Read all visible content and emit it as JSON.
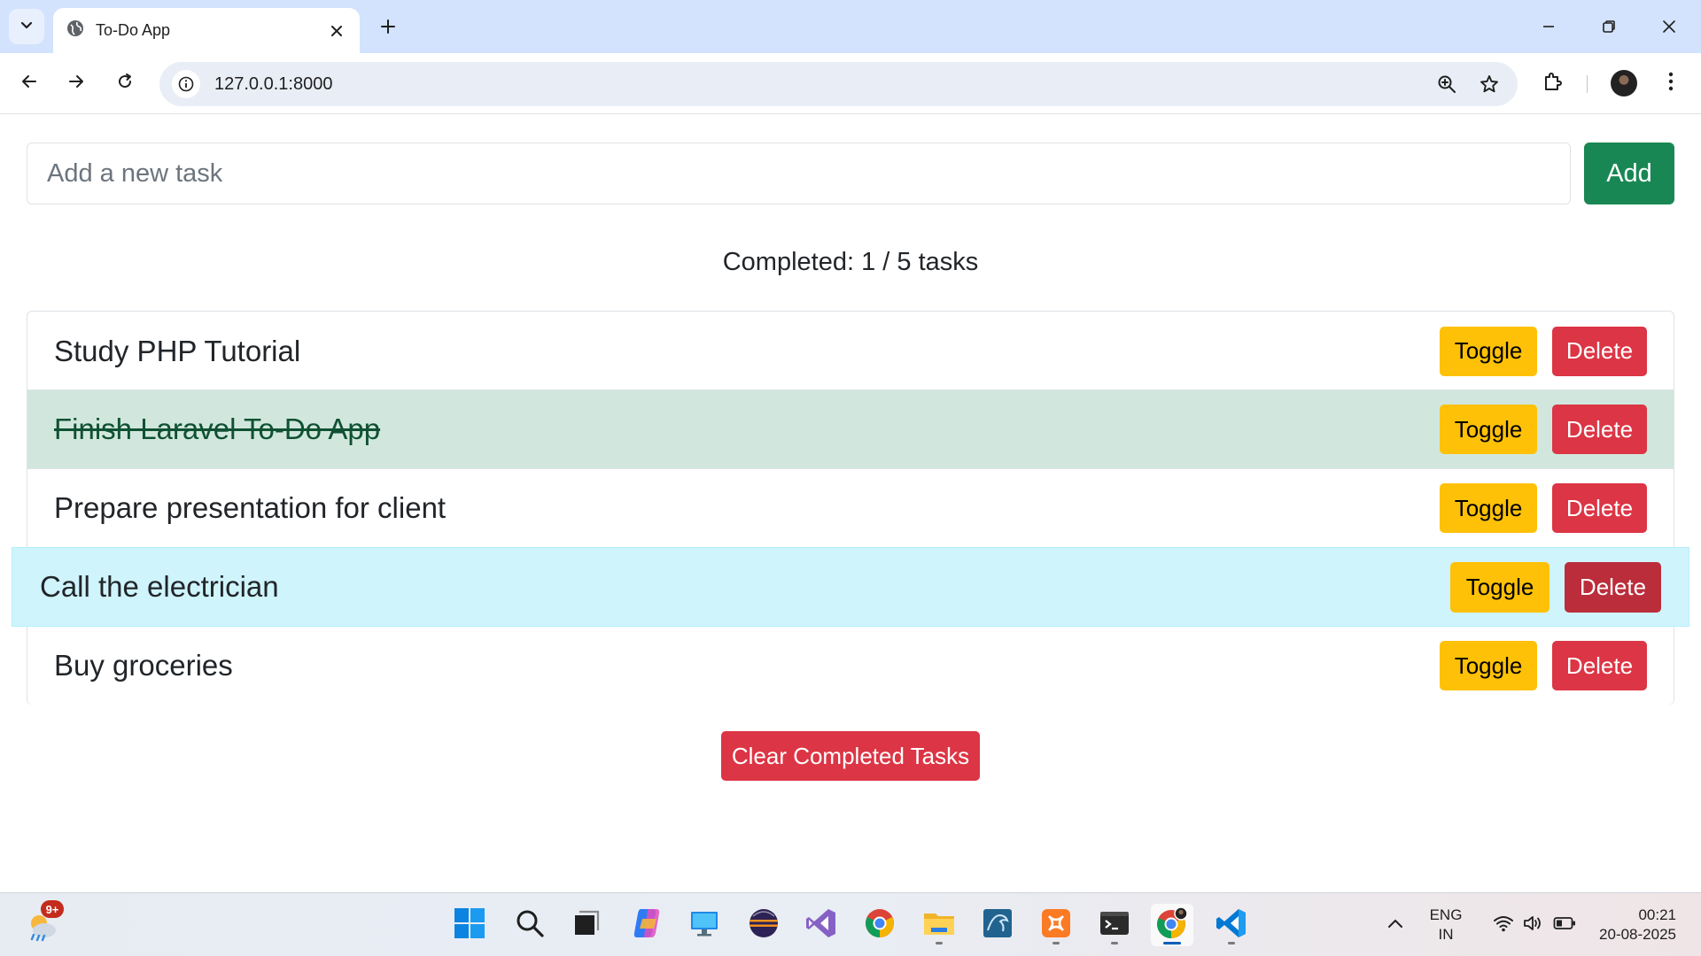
{
  "browser": {
    "tab_title": "To-Do App",
    "url": "127.0.0.1:8000"
  },
  "form": {
    "placeholder": "Add a new task",
    "value": "",
    "add_label": "Add"
  },
  "counter_text": "Completed: 1 / 5 tasks",
  "tasks": [
    {
      "title": "Study PHP Tutorial",
      "completed": false,
      "toggle_label": "Toggle",
      "delete_label": "Delete"
    },
    {
      "title": "Finish Laravel To-Do App",
      "completed": true,
      "toggle_label": "Toggle",
      "delete_label": "Delete"
    },
    {
      "title": "Prepare presentation for client",
      "completed": false,
      "toggle_label": "Toggle",
      "delete_label": "Delete"
    },
    {
      "title": "Call the electrician",
      "completed": false,
      "hovered": true,
      "toggle_label": "Toggle",
      "delete_label": "Delete"
    },
    {
      "title": "Buy groceries",
      "completed": false,
      "toggle_label": "Toggle",
      "delete_label": "Delete"
    }
  ],
  "clear_label": "Clear Completed Tasks",
  "colors": {
    "add": "#198754",
    "toggle": "#ffc107",
    "delete": "#dc3545",
    "completed_row": "#d1e7dd",
    "hover_row": "#cff4fc"
  },
  "taskbar": {
    "weather_badge": "9+",
    "apps": [
      "start-icon",
      "search-icon",
      "task-view-icon",
      "copilot-icon",
      "remote-desktop-icon",
      "eclipse-icon",
      "visual-studio-icon",
      "chrome-icon",
      "file-explorer-icon",
      "mysql-workbench-icon",
      "xampp-icon",
      "terminal-icon",
      "chrome-profile-icon",
      "vscode-icon"
    ],
    "lang_line1": "ENG",
    "lang_line2": "IN",
    "time": "00:21",
    "date": "20-08-2025"
  }
}
